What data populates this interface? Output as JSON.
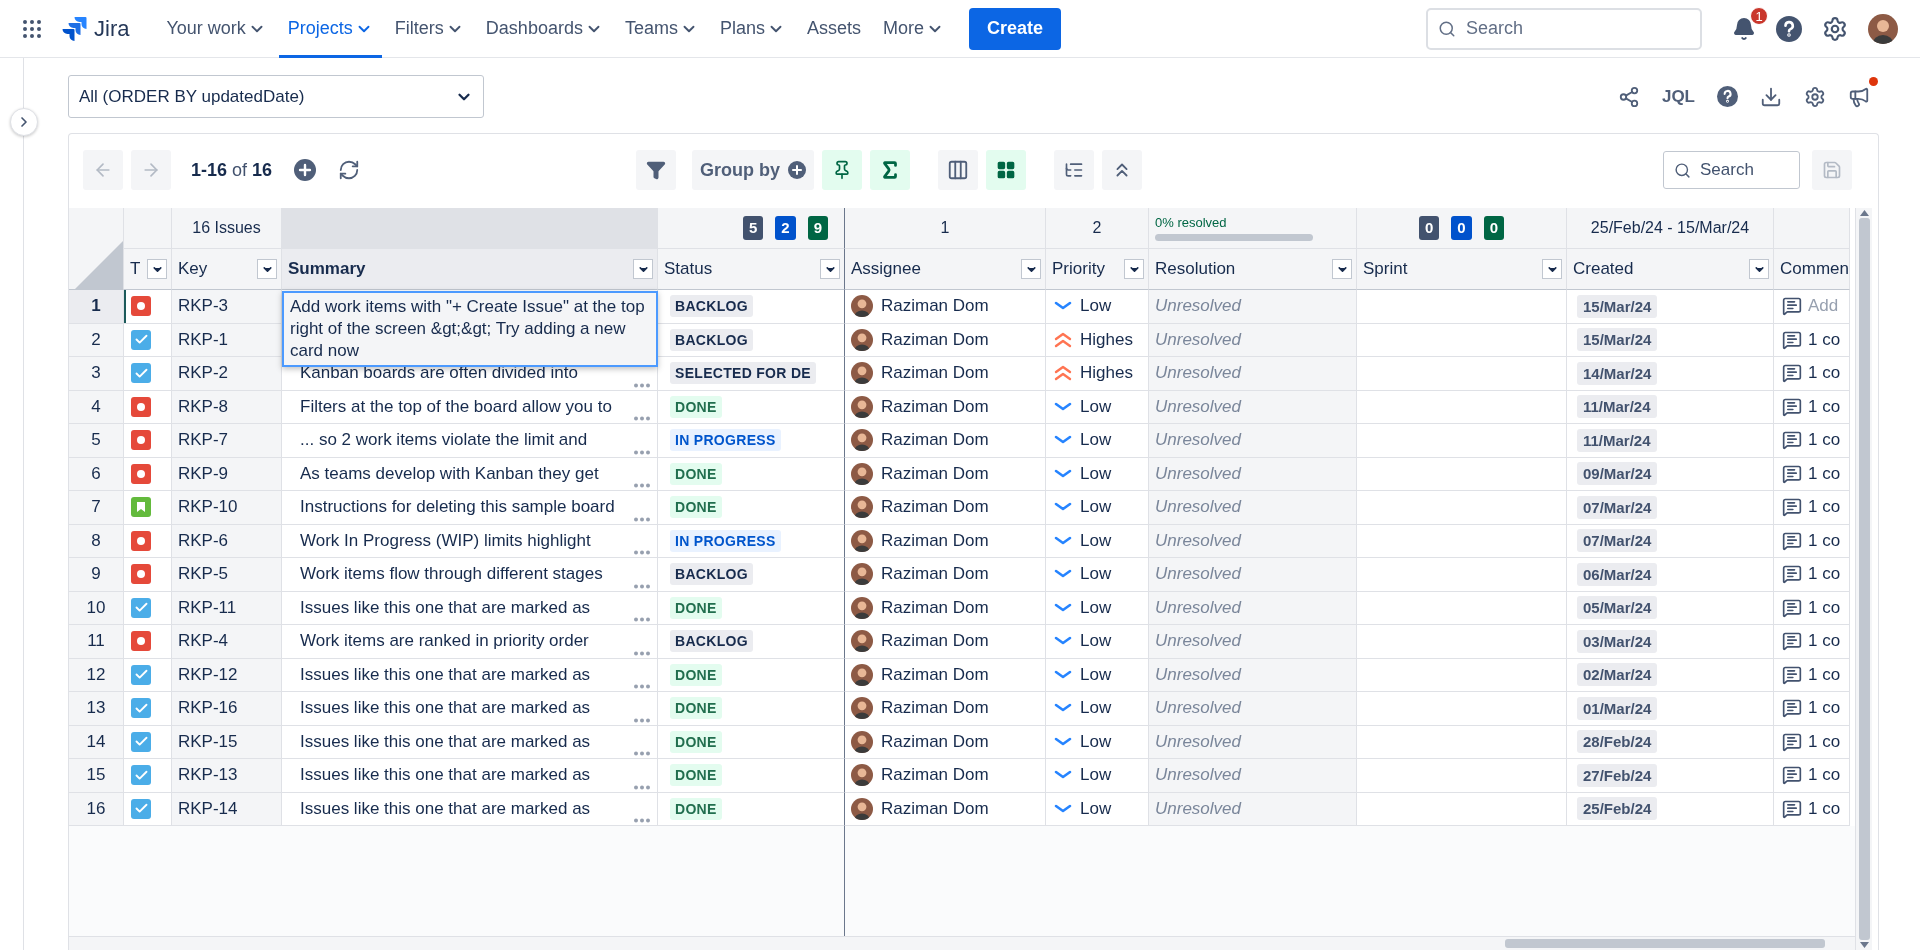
{
  "nav": {
    "product": "Jira",
    "items": [
      {
        "label": "Your work",
        "dropdown": true,
        "selected": false
      },
      {
        "label": "Projects",
        "dropdown": true,
        "selected": true
      },
      {
        "label": "Filters",
        "dropdown": true,
        "selected": false
      },
      {
        "label": "Dashboards",
        "dropdown": true,
        "selected": false
      },
      {
        "label": "Teams",
        "dropdown": true,
        "selected": false
      },
      {
        "label": "Plans",
        "dropdown": true,
        "selected": false
      },
      {
        "label": "Assets",
        "dropdown": false,
        "selected": false
      },
      {
        "label": "More",
        "dropdown": true,
        "selected": false
      }
    ],
    "create": "Create",
    "search": {
      "placeholder": "Search"
    },
    "notification_count": "1"
  },
  "filter": {
    "value": "All (ORDER BY updatedDate)"
  },
  "actions": {
    "jql": "JQL",
    "announcement_unread": true
  },
  "toolbar": {
    "range": "**1-16** of **16**",
    "nav_disabled": true,
    "group_by": "Group by",
    "pin_active": true,
    "sum_active": true,
    "grid_active": true,
    "search": {
      "placeholder": "Search"
    }
  },
  "summary_row": {
    "issues": "16 Issues",
    "status_counts": [
      {
        "value": "5",
        "color": "#42526e"
      },
      {
        "value": "2",
        "color": "#0052cc"
      },
      {
        "value": "9",
        "color": "#006644"
      }
    ],
    "assignees": "1",
    "priorities": "2",
    "resolution": {
      "label": "0% resolved",
      "level": 0
    },
    "sprint_counts": [
      {
        "value": "0",
        "color": "#42526e"
      },
      {
        "value": "0",
        "color": "#0052cc"
      },
      {
        "value": "0",
        "color": "#006644"
      }
    ],
    "created": "25/Feb/24 - 15/Mar/24"
  },
  "columns": [
    {
      "label": "T",
      "selected": false
    },
    {
      "label": "Key",
      "selected": false
    },
    {
      "label": "Summary",
      "selected": true
    },
    {
      "label": "Status",
      "selected": false
    },
    {
      "label": "Assignee",
      "selected": false
    },
    {
      "label": "Priority",
      "selected": false
    },
    {
      "label": "Resolution",
      "selected": false
    },
    {
      "label": "Sprint",
      "selected": false
    },
    {
      "label": "Created",
      "selected": false
    },
    {
      "label": "Commen",
      "selected": false
    }
  ],
  "rows": [
    {
      "number": "1",
      "selected": true,
      "editing": true,
      "kind": "bug",
      "key": "RKP-3",
      "summary": "Add work items with \"+ Create Issue\" at the top right of the screen &gt;&gt; Try adding a new card now",
      "status": {
        "label": "BACKLOG",
        "kind": "todo"
      },
      "assignee": "Raziman Dom",
      "priority": {
        "label": "Low",
        "kind": "low"
      },
      "resolution": "Unresolved",
      "created": "15/Mar/24",
      "comments": {
        "label": "Add",
        "kind": "add"
      }
    },
    {
      "number": "2",
      "selected": false,
      "editing": false,
      "kind": "task",
      "key": "RKP-1",
      "status": {
        "label": "BACKLOG",
        "kind": "todo"
      },
      "assignee": "Raziman Dom",
      "priority": {
        "label": "Highes",
        "kind": "highest"
      },
      "resolution": "Unresolved",
      "created": "15/Mar/24",
      "comments": {
        "label": "1 co",
        "kind": "count"
      }
    },
    {
      "number": "3",
      "selected": false,
      "editing": false,
      "kind": "task",
      "key": "RKP-2",
      "summary": "Kanban boards are often divided into",
      "status": {
        "label": "SELECTED FOR DE",
        "kind": "todo"
      },
      "assignee": "Raziman Dom",
      "priority": {
        "label": "Highes",
        "kind": "highest"
      },
      "resolution": "Unresolved",
      "created": "14/Mar/24",
      "comments": {
        "label": "1 co",
        "kind": "count"
      }
    },
    {
      "number": "4",
      "selected": false,
      "editing": false,
      "kind": "bug",
      "key": "RKP-8",
      "summary": "Filters at the top of the board allow you to",
      "status": {
        "label": "DONE",
        "kind": "done"
      },
      "assignee": "Raziman Dom",
      "priority": {
        "label": "Low",
        "kind": "low"
      },
      "resolution": "Unresolved",
      "created": "11/Mar/24",
      "comments": {
        "label": "1 co",
        "kind": "count"
      }
    },
    {
      "number": "5",
      "selected": false,
      "editing": false,
      "kind": "bug",
      "key": "RKP-7",
      "summary": "... so 2 work items violate the limit and",
      "status": {
        "label": "IN PROGRESS",
        "kind": "inprogress"
      },
      "assignee": "Raziman Dom",
      "priority": {
        "label": "Low",
        "kind": "low"
      },
      "resolution": "Unresolved",
      "created": "11/Mar/24",
      "comments": {
        "label": "1 co",
        "kind": "count"
      }
    },
    {
      "number": "6",
      "selected": false,
      "editing": false,
      "kind": "bug",
      "key": "RKP-9",
      "summary": "As teams develop with Kanban they get",
      "status": {
        "label": "DONE",
        "kind": "done"
      },
      "assignee": "Raziman Dom",
      "priority": {
        "label": "Low",
        "kind": "low"
      },
      "resolution": "Unresolved",
      "created": "09/Mar/24",
      "comments": {
        "label": "1 co",
        "kind": "count"
      }
    },
    {
      "number": "7",
      "selected": false,
      "editing": false,
      "kind": "story",
      "key": "RKP-10",
      "summary": "Instructions for deleting this sample board",
      "status": {
        "label": "DONE",
        "kind": "done"
      },
      "assignee": "Raziman Dom",
      "priority": {
        "label": "Low",
        "kind": "low"
      },
      "resolution": "Unresolved",
      "created": "07/Mar/24",
      "comments": {
        "label": "1 co",
        "kind": "count"
      }
    },
    {
      "number": "8",
      "selected": false,
      "editing": false,
      "kind": "bug",
      "key": "RKP-6",
      "summary": "Work In Progress (WIP) limits highlight",
      "status": {
        "label": "IN PROGRESS",
        "kind": "inprogress"
      },
      "assignee": "Raziman Dom",
      "priority": {
        "label": "Low",
        "kind": "low"
      },
      "resolution": "Unresolved",
      "created": "07/Mar/24",
      "comments": {
        "label": "1 co",
        "kind": "count"
      }
    },
    {
      "number": "9",
      "selected": false,
      "editing": false,
      "kind": "bug",
      "key": "RKP-5",
      "summary": "Work items flow through different stages",
      "status": {
        "label": "BACKLOG",
        "kind": "todo"
      },
      "assignee": "Raziman Dom",
      "priority": {
        "label": "Low",
        "kind": "low"
      },
      "resolution": "Unresolved",
      "created": "06/Mar/24",
      "comments": {
        "label": "1 co",
        "kind": "count"
      }
    },
    {
      "number": "10",
      "selected": false,
      "editing": false,
      "kind": "task",
      "key": "RKP-11",
      "summary": "Issues like this one that are marked as",
      "status": {
        "label": "DONE",
        "kind": "done"
      },
      "assignee": "Raziman Dom",
      "priority": {
        "label": "Low",
        "kind": "low"
      },
      "resolution": "Unresolved",
      "created": "05/Mar/24",
      "comments": {
        "label": "1 co",
        "kind": "count"
      }
    },
    {
      "number": "11",
      "selected": false,
      "editing": false,
      "kind": "bug",
      "key": "RKP-4",
      "summary": "Work items are ranked in priority order",
      "status": {
        "label": "BACKLOG",
        "kind": "todo"
      },
      "assignee": "Raziman Dom",
      "priority": {
        "label": "Low",
        "kind": "low"
      },
      "resolution": "Unresolved",
      "created": "03/Mar/24",
      "comments": {
        "label": "1 co",
        "kind": "count"
      }
    },
    {
      "number": "12",
      "selected": false,
      "editing": false,
      "kind": "task",
      "key": "RKP-12",
      "summary": "Issues like this one that are marked as",
      "status": {
        "label": "DONE",
        "kind": "done"
      },
      "assignee": "Raziman Dom",
      "priority": {
        "label": "Low",
        "kind": "low"
      },
      "resolution": "Unresolved",
      "created": "02/Mar/24",
      "comments": {
        "label": "1 co",
        "kind": "count"
      }
    },
    {
      "number": "13",
      "selected": false,
      "editing": false,
      "kind": "task",
      "key": "RKP-16",
      "summary": "Issues like this one that are marked as",
      "status": {
        "label": "DONE",
        "kind": "done"
      },
      "assignee": "Raziman Dom",
      "priority": {
        "label": "Low",
        "kind": "low"
      },
      "resolution": "Unresolved",
      "created": "01/Mar/24",
      "comments": {
        "label": "1 co",
        "kind": "count"
      }
    },
    {
      "number": "14",
      "selected": false,
      "editing": false,
      "kind": "task",
      "key": "RKP-15",
      "summary": "Issues like this one that are marked as",
      "status": {
        "label": "DONE",
        "kind": "done"
      },
      "assignee": "Raziman Dom",
      "priority": {
        "label": "Low",
        "kind": "low"
      },
      "resolution": "Unresolved",
      "created": "28/Feb/24",
      "comments": {
        "label": "1 co",
        "kind": "count"
      }
    },
    {
      "number": "15",
      "selected": false,
      "editing": false,
      "kind": "task",
      "key": "RKP-13",
      "summary": "Issues like this one that are marked as",
      "status": {
        "label": "DONE",
        "kind": "done"
      },
      "assignee": "Raziman Dom",
      "priority": {
        "label": "Low",
        "kind": "low"
      },
      "resolution": "Unresolved",
      "created": "27/Feb/24",
      "comments": {
        "label": "1 co",
        "kind": "count"
      }
    },
    {
      "number": "16",
      "selected": false,
      "editing": false,
      "kind": "task",
      "key": "RKP-14",
      "summary": "Issues like this one that are marked as",
      "status": {
        "label": "DONE",
        "kind": "done"
      },
      "assignee": "Raziman Dom",
      "priority": {
        "label": "Low",
        "kind": "low"
      },
      "resolution": "Unresolved",
      "created": "25/Feb/24",
      "comments": {
        "label": "1 co",
        "kind": "count"
      }
    }
  ]
}
